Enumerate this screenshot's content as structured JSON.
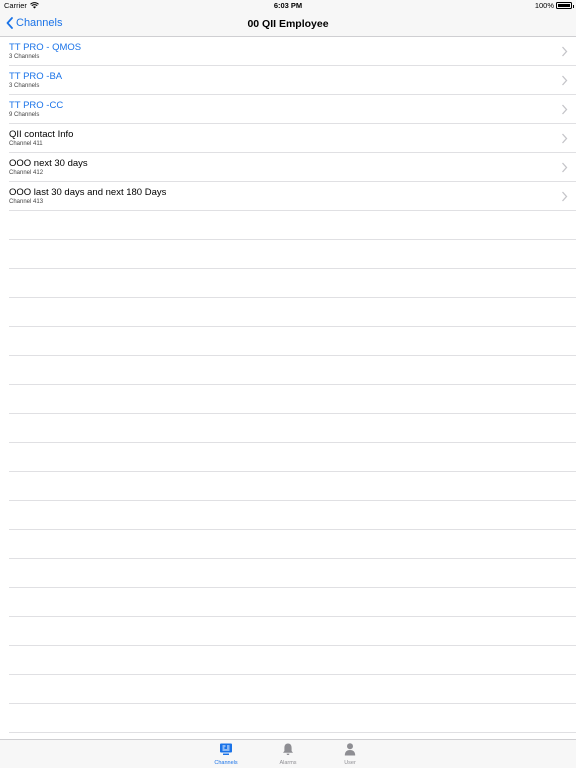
{
  "status_bar": {
    "carrier": "Carrier",
    "time": "6:03 PM",
    "battery": "100%"
  },
  "nav": {
    "back_label": "Channels",
    "title": "00 QII Employee"
  },
  "rows": [
    {
      "title": "TT PRO - QMOS",
      "subtitle": "3 Channels",
      "color": "#1a73e8"
    },
    {
      "title": "TT PRO -BA",
      "subtitle": "3 Channels",
      "color": "#1a73e8"
    },
    {
      "title": "TT PRO -CC",
      "subtitle": "9 Channels",
      "color": "#1a73e8"
    },
    {
      "title": "QII contact Info",
      "subtitle": "Channel 411",
      "color": "#000000"
    },
    {
      "title": "OOO next 30 days",
      "subtitle": "Channel 412",
      "color": "#000000"
    },
    {
      "title": "OOO last 30 days and next 180 Days",
      "subtitle": "Channel 413",
      "color": "#000000"
    }
  ],
  "tabs": [
    {
      "label": "Channels",
      "icon": "channels-icon",
      "active": true
    },
    {
      "label": "Alarms",
      "icon": "bell-icon",
      "active": false
    },
    {
      "label": "User",
      "icon": "user-icon",
      "active": false
    }
  ],
  "colors": {
    "accent": "#1a73e8",
    "inactive": "#8e8e93",
    "separator": "#e0e0e3"
  }
}
